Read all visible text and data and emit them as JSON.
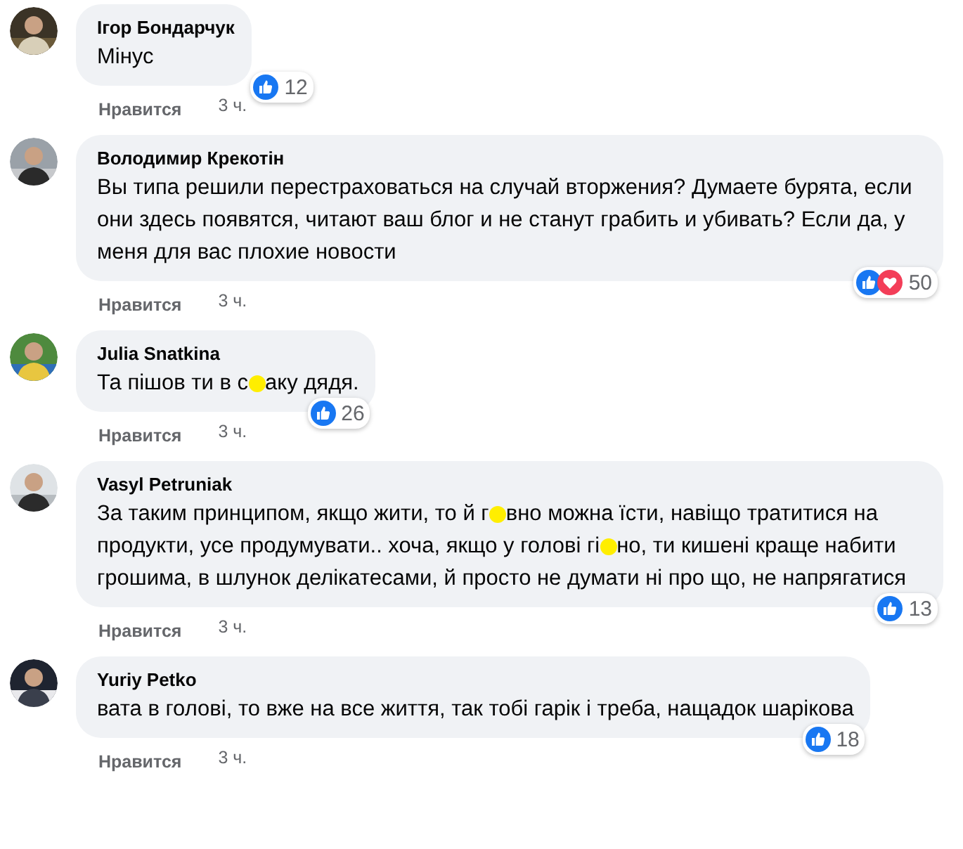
{
  "comments": [
    {
      "author": "Ігор Бондарчук",
      "avatar": {
        "kind": "picture"
      },
      "body": [
        {
          "kind": "text",
          "text": "Мінус"
        }
      ],
      "reactions": [
        {
          "kind": "like"
        }
      ],
      "reaction_count": "12",
      "like_label": "Нравится",
      "time": "3 ч."
    },
    {
      "author": "Володимир Крекотін",
      "avatar": {
        "kind": "picture"
      },
      "body": [
        {
          "kind": "text",
          "text": "Вы типа решили перестраховаться на случай вторжения? Думаете бурята, если они здесь появятся, читают ваш блог и не станут грабить и убивать? Если да, у меня для вас плохие новости"
        }
      ],
      "reactions": [
        {
          "kind": "like"
        },
        {
          "kind": "love"
        }
      ],
      "reaction_count": "50",
      "like_label": "Нравится",
      "time": "3 ч."
    },
    {
      "author": "Julia Snatkina",
      "avatar": {
        "kind": "picture"
      },
      "body": [
        {
          "kind": "text",
          "text": "Та пішов ти в с"
        },
        {
          "kind": "censor"
        },
        {
          "kind": "text",
          "text": "аку дядя."
        }
      ],
      "reactions": [
        {
          "kind": "like"
        }
      ],
      "reaction_count": "26",
      "like_label": "Нравится",
      "time": "3 ч."
    },
    {
      "author": "Vasyl Petruniak",
      "avatar": {
        "kind": "picture"
      },
      "body": [
        {
          "kind": "text",
          "text": "За таким принципом, якщо жити, то й г"
        },
        {
          "kind": "censor"
        },
        {
          "kind": "text",
          "text": "вно можна їсти, навіщо тратитися на продукти, усе продумувати.. хоча, якщо у голові гі"
        },
        {
          "kind": "censor"
        },
        {
          "kind": "text",
          "text": "но, ти кишені краще набити грошима, в шлунок делікатесами, й просто не думати ні про що, не напрягатися"
        }
      ],
      "reactions": [
        {
          "kind": "like"
        }
      ],
      "reaction_count": "13",
      "like_label": "Нравится",
      "time": "3 ч."
    },
    {
      "author": "Yuriy Petko",
      "avatar": {
        "kind": "picture"
      },
      "body": [
        {
          "kind": "text",
          "text": "вата в голові, то вже на все життя, так тобі гарік і треба, нащадок шарікова"
        }
      ],
      "reactions": [
        {
          "kind": "like"
        }
      ],
      "reaction_count": "18",
      "like_label": "Нравится",
      "time": "3 ч."
    }
  ]
}
